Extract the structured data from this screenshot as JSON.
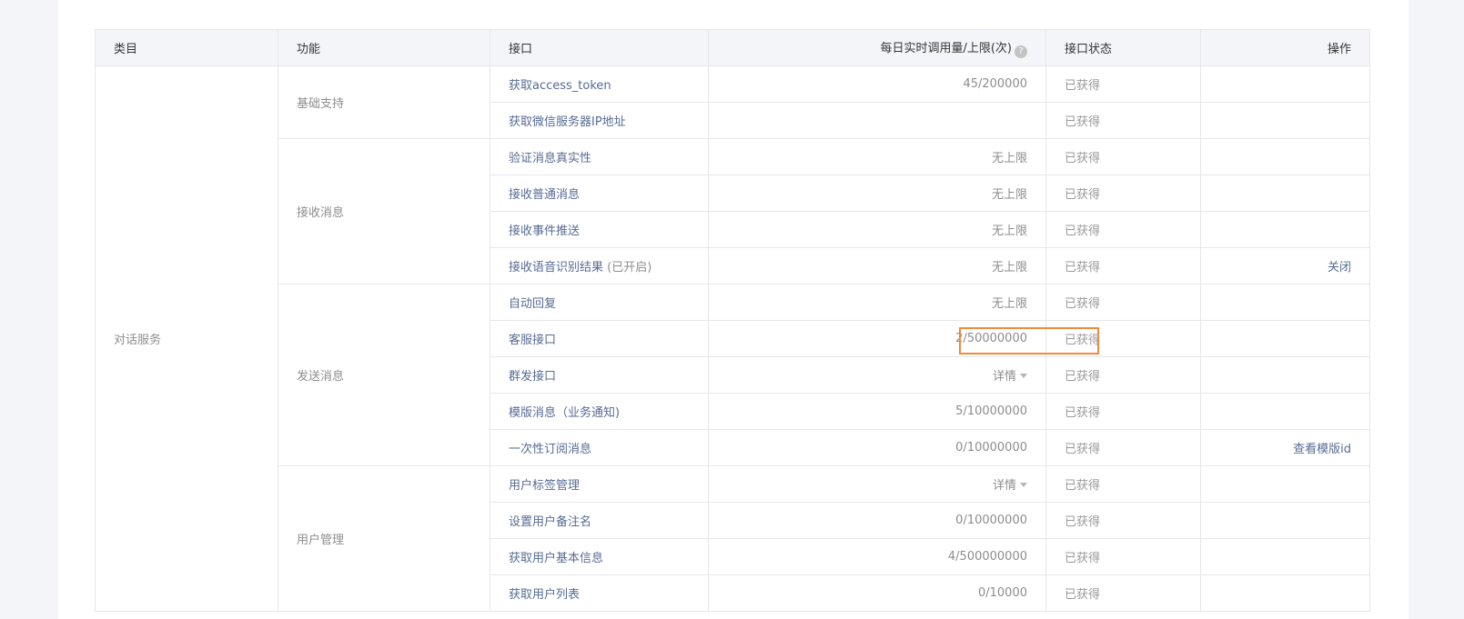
{
  "header": {
    "category": "类目",
    "function": "功能",
    "api": "接口",
    "usage": "每日实时调用量/上限(次)",
    "usage_help_icon": "question-circle-icon",
    "status": "接口状态",
    "operation": "操作"
  },
  "category": "对话服务",
  "groups": {
    "basic": "基础支持",
    "receive": "接收消息",
    "send": "发送消息",
    "user": "用户管理"
  },
  "rows": [
    {
      "api": "获取access_token",
      "usage": "45/200000",
      "status": "已获得",
      "op": ""
    },
    {
      "api": "获取微信服务器IP地址",
      "usage": "",
      "status": "已获得",
      "op": ""
    },
    {
      "api": "验证消息真实性",
      "usage": "无上限",
      "status": "已获得",
      "op": ""
    },
    {
      "api": "接收普通消息",
      "usage": "无上限",
      "status": "已获得",
      "op": ""
    },
    {
      "api": "接收事件推送",
      "usage": "无上限",
      "status": "已获得",
      "op": ""
    },
    {
      "api": "接收语音识别结果",
      "api_suffix": " (已开启)",
      "usage": "无上限",
      "status": "已获得",
      "op": "关闭"
    },
    {
      "api": "自动回复",
      "usage": "无上限",
      "status": "已获得",
      "op": ""
    },
    {
      "api": "客服接口",
      "usage": "2/50000000",
      "status": "已获得",
      "op": ""
    },
    {
      "api": "群发接口",
      "usage": "详情",
      "status": "已获得",
      "op": ""
    },
    {
      "api": "模版消息（业务通知)",
      "usage": "5/10000000",
      "status": "已获得",
      "op": ""
    },
    {
      "api": "一次性订阅消息",
      "usage": "0/10000000",
      "status": "已获得",
      "op": "查看模版id"
    },
    {
      "api": "用户标签管理",
      "usage": "详情",
      "status": "已获得",
      "op": ""
    },
    {
      "api": "设置用户备注名",
      "usage": "0/10000000",
      "status": "已获得",
      "op": ""
    },
    {
      "api": "获取用户基本信息",
      "usage": "4/500000000",
      "status": "已获得",
      "op": ""
    },
    {
      "api": "获取用户列表",
      "usage": "0/10000",
      "status": "已获得",
      "op": ""
    }
  ],
  "colors": {
    "link": "#576b95",
    "muted": "#8d8d8d",
    "highlight_box": "#f5893b",
    "header_bg": "#f4f5f9"
  }
}
